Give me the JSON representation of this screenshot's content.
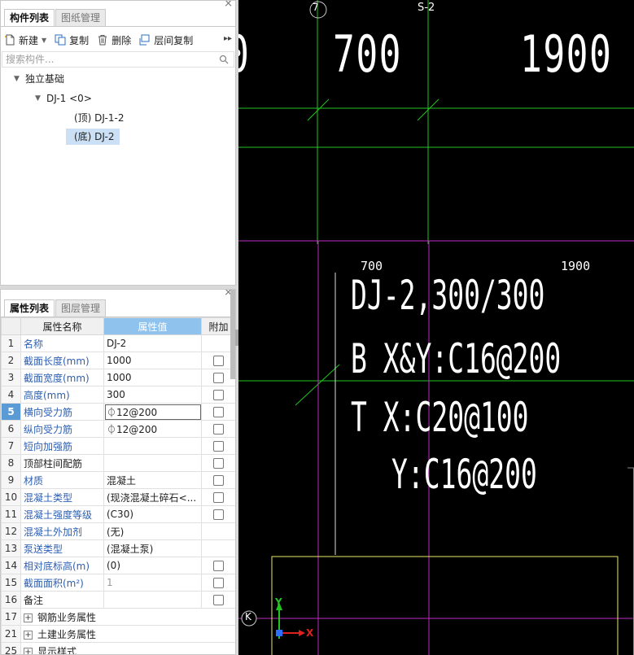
{
  "component_panel": {
    "tabs": [
      {
        "label": "构件列表",
        "active": true
      },
      {
        "label": "图纸管理",
        "active": false
      }
    ],
    "toolbar": {
      "new_label": "新建",
      "copy_label": "复制",
      "delete_label": "删除",
      "floor_copy_label": "层间复制"
    },
    "search_placeholder": "搜索构件...",
    "tree": {
      "root": "独立基础",
      "node": "DJ-1 <0>",
      "leaves": [
        {
          "label": "(顶) DJ-1-2",
          "selected": false
        },
        {
          "label": "(底) DJ-2",
          "selected": true
        }
      ]
    }
  },
  "property_panel": {
    "tabs": [
      {
        "label": "属性列表",
        "active": true
      },
      {
        "label": "图层管理",
        "active": false
      }
    ],
    "headers": {
      "name": "属性名称",
      "value": "属性值",
      "extra": "附加"
    },
    "rows": [
      {
        "num": "1",
        "name": "名称",
        "value": "DJ-2",
        "blue": true,
        "checkbox": false
      },
      {
        "num": "2",
        "name": "截面长度(mm)",
        "value": "1000",
        "blue": true,
        "checkbox": true
      },
      {
        "num": "3",
        "name": "截面宽度(mm)",
        "value": "1000",
        "blue": true,
        "checkbox": true
      },
      {
        "num": "4",
        "name": "高度(mm)",
        "value": "300",
        "blue": true,
        "checkbox": true
      },
      {
        "num": "5",
        "name": "横向受力筋",
        "value": "⏀12@200",
        "blue": true,
        "checkbox": true,
        "selected": true
      },
      {
        "num": "6",
        "name": "纵向受力筋",
        "value": "⏀12@200",
        "blue": true,
        "checkbox": true
      },
      {
        "num": "7",
        "name": "短向加强筋",
        "value": "",
        "blue": true,
        "checkbox": true
      },
      {
        "num": "8",
        "name": "顶部柱间配筋",
        "value": "",
        "blue": false,
        "checkbox": true
      },
      {
        "num": "9",
        "name": "材质",
        "value": "混凝土",
        "blue": true,
        "checkbox": true
      },
      {
        "num": "10",
        "name": "混凝土类型",
        "value": "(现浇混凝土碎石<...",
        "blue": true,
        "checkbox": true
      },
      {
        "num": "11",
        "name": "混凝土强度等级",
        "value": "(C30)",
        "blue": true,
        "checkbox": true
      },
      {
        "num": "12",
        "name": "混凝土外加剂",
        "value": "(无)",
        "blue": true,
        "checkbox": false
      },
      {
        "num": "13",
        "name": "泵送类型",
        "value": "(混凝土泵)",
        "blue": true,
        "checkbox": false
      },
      {
        "num": "14",
        "name": "相对底标高(m)",
        "value": "(0)",
        "blue": true,
        "checkbox": true
      },
      {
        "num": "15",
        "name": "截面面积(m²)",
        "value": "1",
        "blue": true,
        "checkbox": true,
        "gray": true
      },
      {
        "num": "16",
        "name": "备注",
        "value": "",
        "blue": false,
        "checkbox": true
      },
      {
        "num": "17",
        "name": "钢筋业务属性",
        "group": true
      },
      {
        "num": "21",
        "name": "土建业务属性",
        "group": true
      },
      {
        "num": "25",
        "name": "显示样式",
        "group": true
      }
    ]
  },
  "cad": {
    "axis_top_left": "7",
    "axis_top_right": "S-2",
    "axis_left": "K",
    "dim_large_left_partial": "0",
    "dim_large_mid": "700",
    "dim_large_right": "1900",
    "dim_small_left": "700",
    "dim_small_right": "1900",
    "annotation_lines": [
      "DJ-2,300/300",
      "B X&Y:C16@200",
      "T X:C20@100",
      "Y:C16@200"
    ],
    "ucs_y": "Y",
    "ucs_x": "X",
    "colors": {
      "background": "#000000",
      "grid_green": "#22c422",
      "axis_magenta": "#c02ac0",
      "outline_yellow": "#e8e86a",
      "text_white": "#ffffff"
    }
  }
}
